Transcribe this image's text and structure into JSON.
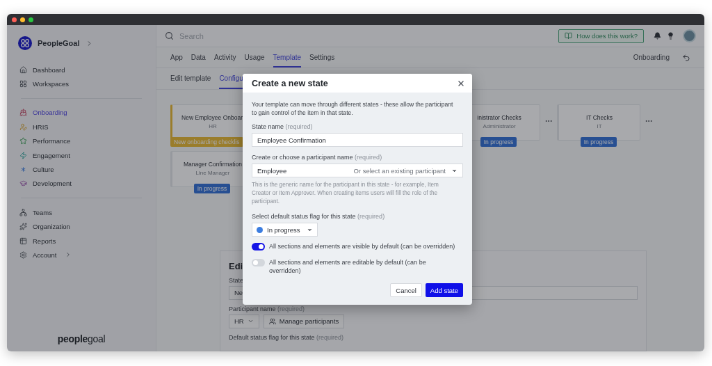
{
  "sidebar": {
    "brand": "PeopleGoal",
    "sections": [
      {
        "items": [
          {
            "label": "Dashboard",
            "selected": false,
            "submenu": false
          },
          {
            "label": "Workspaces",
            "selected": false,
            "submenu": false
          }
        ]
      },
      {
        "items": [
          {
            "label": "Onboarding",
            "selected": true,
            "submenu": false
          },
          {
            "label": "HRIS",
            "selected": false,
            "submenu": false
          },
          {
            "label": "Performance",
            "selected": false,
            "submenu": false
          },
          {
            "label": "Engagement",
            "selected": false,
            "submenu": false
          },
          {
            "label": "Culture",
            "selected": false,
            "submenu": false
          },
          {
            "label": "Development",
            "selected": false,
            "submenu": false
          }
        ]
      },
      {
        "items": [
          {
            "label": "Teams",
            "selected": false,
            "submenu": false
          },
          {
            "label": "Organization",
            "selected": false,
            "submenu": false
          },
          {
            "label": "Reports",
            "selected": false,
            "submenu": false
          },
          {
            "label": "Account",
            "selected": false,
            "submenu": true
          }
        ]
      }
    ],
    "footer_logo": "**people**goal"
  },
  "topbar": {
    "search_placeholder": "Search",
    "help_button": "How does this work?"
  },
  "tabs": [
    {
      "label": "App",
      "selected": false
    },
    {
      "label": "Data",
      "selected": false
    },
    {
      "label": "Activity",
      "selected": false
    },
    {
      "label": "Usage",
      "selected": false
    },
    {
      "label": "Template",
      "selected": true
    },
    {
      "label": "Settings",
      "selected": false
    }
  ],
  "context_label": "Onboarding",
  "subtabs": [
    {
      "label": "Edit template",
      "selected": false
    },
    {
      "label": "Configu",
      "selected": true
    }
  ],
  "state_rows": [
    [
      {
        "title": "New Employee Onboar.",
        "role": "HR",
        "badge": "New onboarding checklis",
        "kind": "checklist"
      },
      {
        "title": "inistrator Checks",
        "role": "Administrator",
        "badge": "In progress",
        "kind": "status"
      },
      {
        "title": "IT Checks",
        "role": "IT",
        "badge": "In progress",
        "kind": "status"
      }
    ],
    [
      {
        "title": "Manager Confirmation",
        "role": "Line Manager",
        "badge": "In progress",
        "kind": "status"
      }
    ]
  ],
  "edit_panel": {
    "title": "Edi",
    "state_label": "State",
    "state_value": "Ne",
    "participant_label": "Participant name",
    "participant_required": "(required)",
    "participant_value": "HR",
    "manage_button": "Manage participants",
    "flag_label": "Default status flag for this state",
    "flag_required": "(required)"
  },
  "modal": {
    "title": "Create a new state",
    "intro": "Your template can move through different states - these allow the participant to gain control of the item in that state.",
    "state_name_label": "State name",
    "state_name_required": "(required)",
    "state_name_value": "Employee Confirmation",
    "participant_label": "Create or choose a participant name",
    "participant_required": "(required)",
    "participant_value": "Employee",
    "participant_select": "Or select an existing participant",
    "participant_help": "This is the generic name for the participant in this state - for example, Item Creator or Item Approver. When creating items users will fill the role of the participant.",
    "flag_label": "Select default status flag for this state",
    "flag_required": "(required)",
    "flag": {
      "label": "In progress",
      "color": "#3b7de0"
    },
    "toggles": [
      {
        "label": "All sections and elements are visible by default (can be overridden)",
        "on": true
      },
      {
        "label": "All sections and elements are editable by default (can be overridden)",
        "on": false
      }
    ],
    "cancel": "Cancel",
    "submit": "Add state"
  }
}
